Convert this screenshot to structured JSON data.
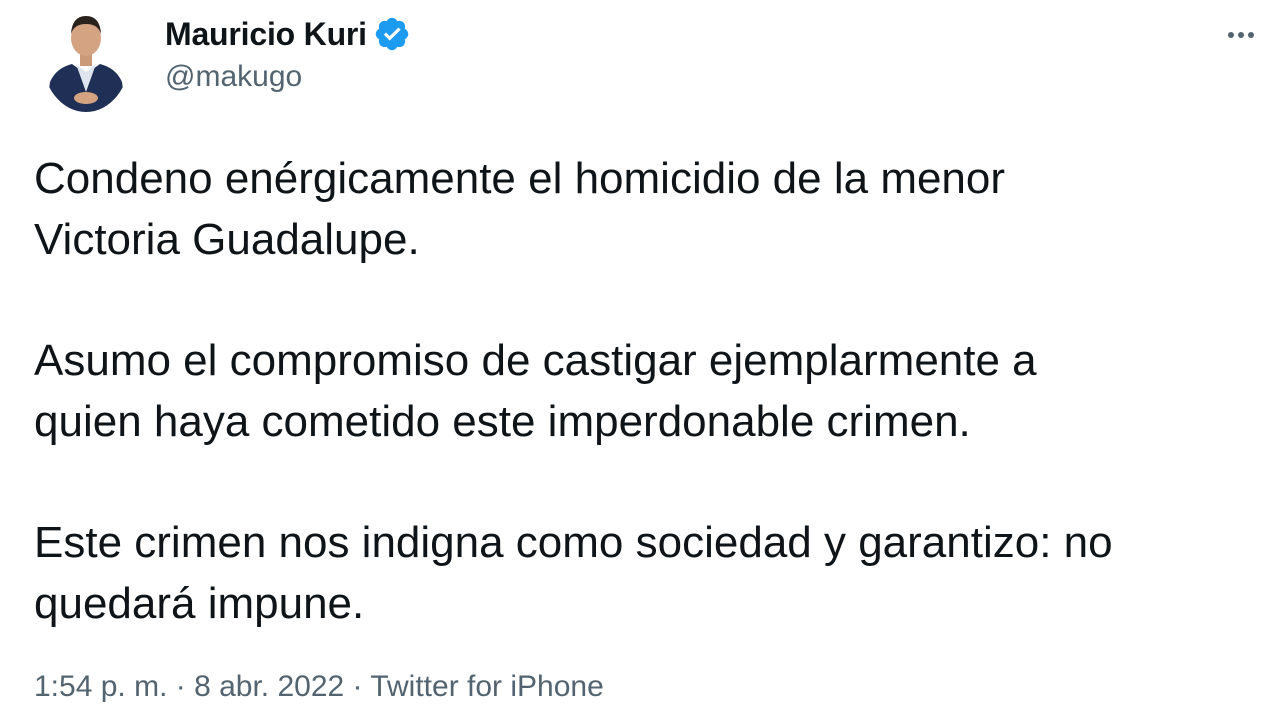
{
  "tweet": {
    "author": {
      "name": "Mauricio Kuri",
      "handle": "@makugo",
      "verified": true
    },
    "paragraphs": [
      "Condeno enérgicamente el homicidio de la menor\nVictoria Guadalupe.",
      "Asumo el compromiso de castigar ejemplarmente a\nquien haya cometido este imperdonable crimen.",
      "Este crimen nos indigna como sociedad y garantizo: no\nquedará impune."
    ],
    "meta": {
      "time": "1:54 p. m.",
      "sep1": " · ",
      "date": "8 abr. 2022",
      "sep2": " · ",
      "source": "Twitter for iPhone"
    }
  },
  "icons": {
    "verified": "verified-badge-icon",
    "more": "more-options-icon"
  },
  "colors": {
    "verified_blue": "#1d9bf0",
    "secondary_text": "#536471",
    "primary_text": "#0f1419"
  }
}
